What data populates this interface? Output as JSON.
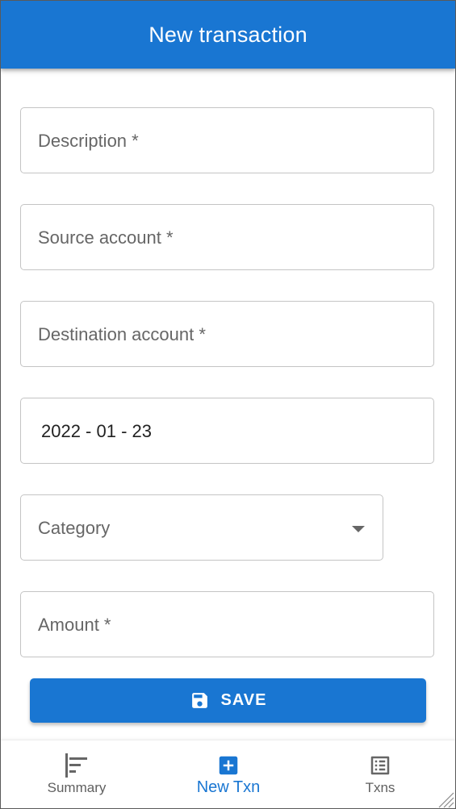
{
  "header": {
    "title": "New transaction"
  },
  "form": {
    "description_label": "Description *",
    "source_label": "Source account *",
    "destination_label": "Destination account *",
    "date_value": "2022 - 01 - 23",
    "category_label": "Category",
    "amount_label": "Amount *"
  },
  "actions": {
    "save_label": "SAVE",
    "save_icon": "floppy-disk-icon"
  },
  "bottom_nav": {
    "items": [
      {
        "label": "Summary",
        "icon": "summary-bars-icon",
        "active": false
      },
      {
        "label": "New Txn",
        "icon": "add-box-icon",
        "active": true
      },
      {
        "label": "Txns",
        "icon": "list-icon",
        "active": false
      }
    ]
  },
  "colors": {
    "primary": "#1976d2",
    "field_border": "#c4c4c4",
    "label_gray": "#666666"
  }
}
